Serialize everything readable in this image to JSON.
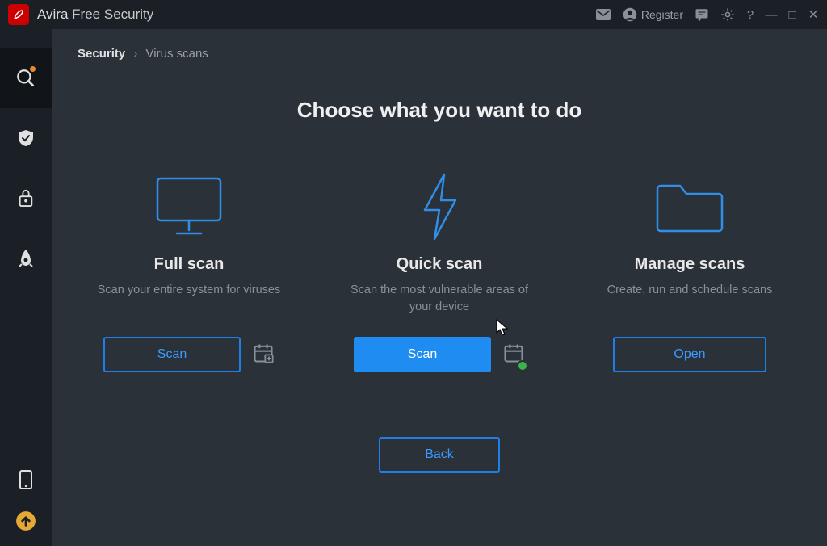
{
  "app": {
    "brand": "Avira",
    "suffix": "Free Security"
  },
  "titlebar": {
    "register_label": "Register"
  },
  "breadcrumb": {
    "root": "Security",
    "sep": "›",
    "current": "Virus scans"
  },
  "page_title": "Choose what you want to do",
  "cards": {
    "full_scan": {
      "title": "Full scan",
      "desc": "Scan your entire system for viruses",
      "button": "Scan"
    },
    "quick_scan": {
      "title": "Quick scan",
      "desc": "Scan the most vulnerable areas of your device",
      "button": "Scan"
    },
    "manage_scans": {
      "title": "Manage scans",
      "desc": "Create, run and schedule scans",
      "button": "Open"
    }
  },
  "back_button": "Back",
  "colors": {
    "accent": "#1e8cf0",
    "outline": "#1e7fe6",
    "brand_red": "#cc0000",
    "status_green": "#3bb34a"
  },
  "icons": {
    "full_scan": "monitor-icon",
    "quick_scan": "bolt-icon",
    "manage_scans": "folder-icon",
    "schedule": "calendar-add-icon",
    "schedule_checked": "calendar-check-icon"
  }
}
